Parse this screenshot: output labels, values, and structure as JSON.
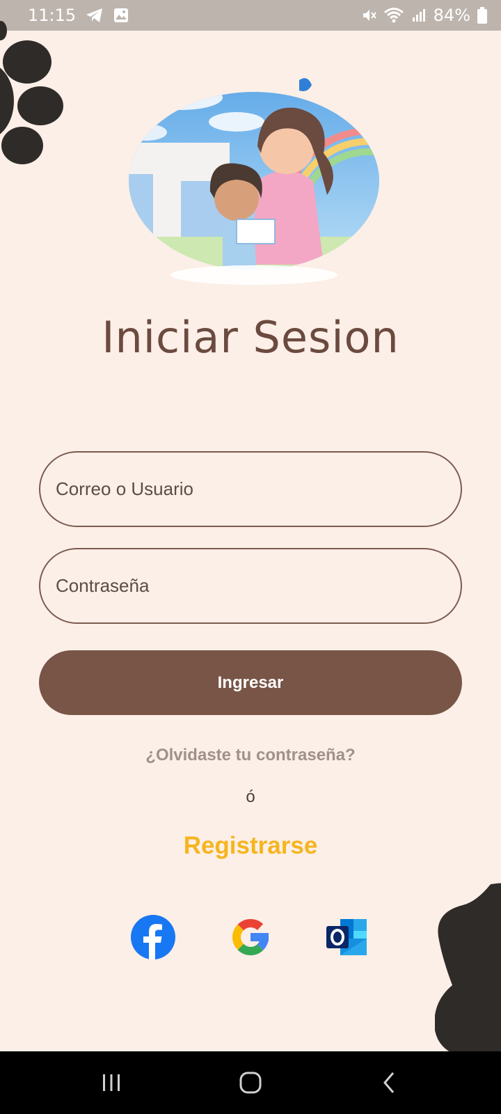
{
  "status_bar": {
    "time": "11:15",
    "battery": "84%",
    "icons": [
      "telegram-icon",
      "gallery-icon",
      "mute-icon",
      "wifi-icon",
      "signal-icon",
      "battery-icon"
    ]
  },
  "login": {
    "title": "Iniciar Sesion",
    "user_placeholder": "Correo o Usuario",
    "password_placeholder": "Contraseña",
    "submit_label": "Ingresar",
    "forgot_label": "¿Olvidaste tu contraseña?",
    "or_label": "ó",
    "register_label": "Registrarse"
  },
  "social_logins": [
    "facebook-icon",
    "google-icon",
    "outlook-icon"
  ],
  "nav_bar": [
    "recent-apps-icon",
    "home-icon",
    "back-icon"
  ],
  "colors": {
    "background": "#fcefe7",
    "accent": "#785547",
    "register": "#f6b51e",
    "decor": "#2f2b29"
  }
}
